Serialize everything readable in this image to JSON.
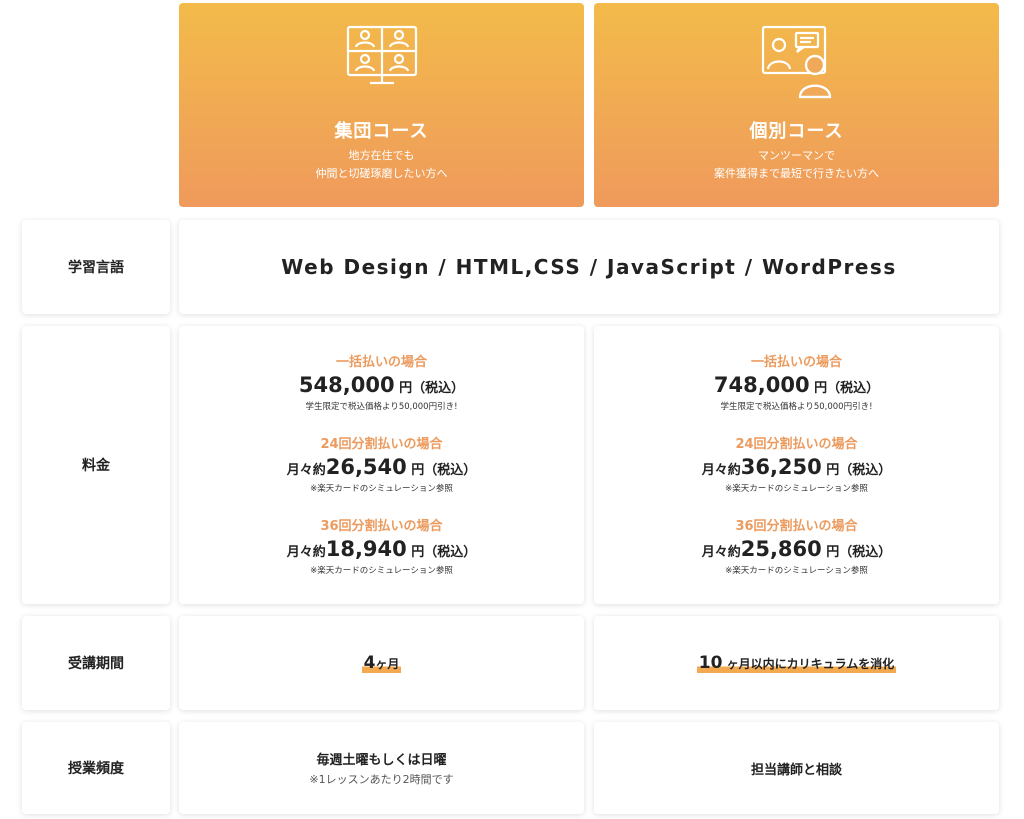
{
  "courses": [
    {
      "icon": "video-conference-icon",
      "title": "集団コース",
      "subtitle_lines": [
        "地方在住でも",
        "仲間と切磋琢磨したい方へ"
      ]
    },
    {
      "icon": "presentation-icon",
      "title": "個別コース",
      "subtitle_lines": [
        "マンツーマンで",
        "案件獲得まで最短で行きたい方へ"
      ]
    }
  ],
  "rows": {
    "languages": {
      "label": "学習言語",
      "value": "Web Design / HTML,CSS / JavaScript / WordPress"
    },
    "pricing": {
      "label": "料金",
      "plans": [
        {
          "lump_title": "一括払いの場合",
          "lump_amount": "548,000",
          "lump_unit": " 円（税込）",
          "lump_note": "学生限定で税込価格より50,000円引き!",
          "i24_title": "24回分割払いの場合",
          "i24_prefix": "月々約",
          "i24_amount": "26,540",
          "i24_unit": " 円（税込）",
          "i24_note": "※楽天カードのシミュレーション参照",
          "i36_title": "36回分割払いの場合",
          "i36_prefix": "月々約",
          "i36_amount": "18,940",
          "i36_unit": " 円（税込）",
          "i36_note": "※楽天カードのシミュレーション参照"
        },
        {
          "lump_title": "一括払いの場合",
          "lump_amount": "748,000",
          "lump_unit": " 円（税込）",
          "lump_note": "学生限定で税込価格より50,000円引き!",
          "i24_title": "24回分割払いの場合",
          "i24_prefix": "月々約",
          "i24_amount": "36,250",
          "i24_unit": " 円（税込）",
          "i24_note": "※楽天カードのシミュレーション参照",
          "i36_title": "36回分割払いの場合",
          "i36_prefix": "月々約",
          "i36_amount": "25,860",
          "i36_unit": " 円（税込）",
          "i36_note": "※楽天カードのシミュレーション参照"
        }
      ]
    },
    "period": {
      "label": "受講期間",
      "group_num": "4",
      "group_unit": "ヶ月",
      "individual_num": "10",
      "individual_unit": " ヶ月以内にカリキュラムを消化"
    },
    "frequency": {
      "label": "授業頻度",
      "group_main": "毎週土曜もしくは日曜",
      "group_note": "※1レッスンあたり2時間です",
      "individual_main": "担当講師と相談"
    }
  },
  "colors": {
    "header_gradient_top": "#f3bb4a",
    "header_gradient_bottom": "#ef9a5c",
    "accent_orange": "#ec9b5e",
    "underline_highlight": "#f2a94f"
  }
}
